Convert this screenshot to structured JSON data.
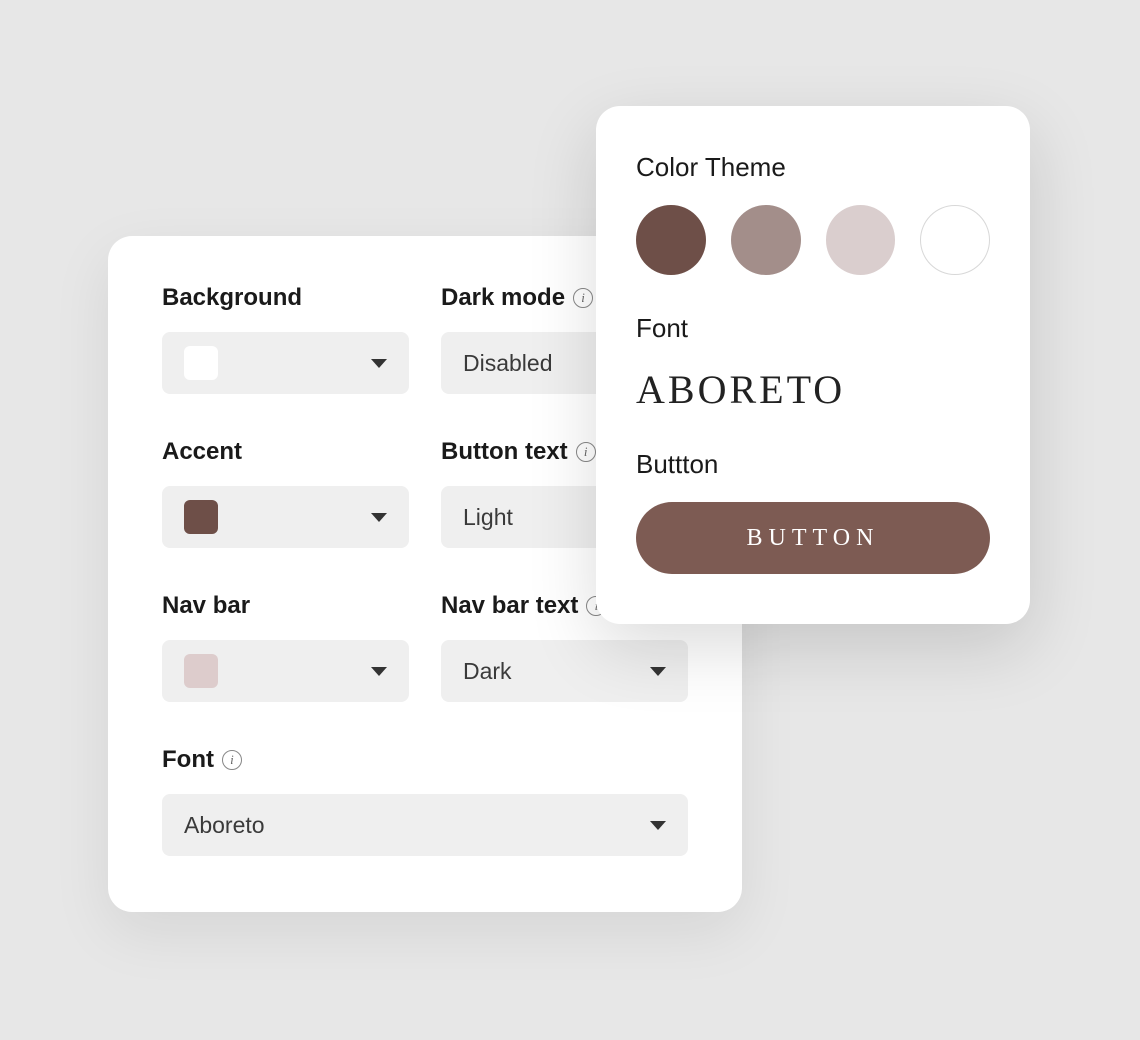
{
  "settings": {
    "background": {
      "label": "Background",
      "swatch_color": "#ffffff"
    },
    "dark_mode": {
      "label": "Dark mode",
      "value": "Disabled"
    },
    "accent": {
      "label": "Accent",
      "swatch_color": "#6e4f48"
    },
    "button_text": {
      "label": "Button text",
      "value": "Light"
    },
    "nav_bar": {
      "label": "Nav bar",
      "swatch_color": "#ddcccc"
    },
    "nav_bar_text": {
      "label": "Nav bar text",
      "value": "Dark"
    },
    "font": {
      "label": "Font",
      "value": "Aboreto"
    }
  },
  "preview": {
    "color_theme_label": "Color Theme",
    "swatches": [
      "#6e4f48",
      "#a38e8a",
      "#dacece",
      "#ffffff"
    ],
    "font_label": "Font",
    "font_display": "Aboreto",
    "button_label": "Buttton",
    "button_text": "Button"
  }
}
